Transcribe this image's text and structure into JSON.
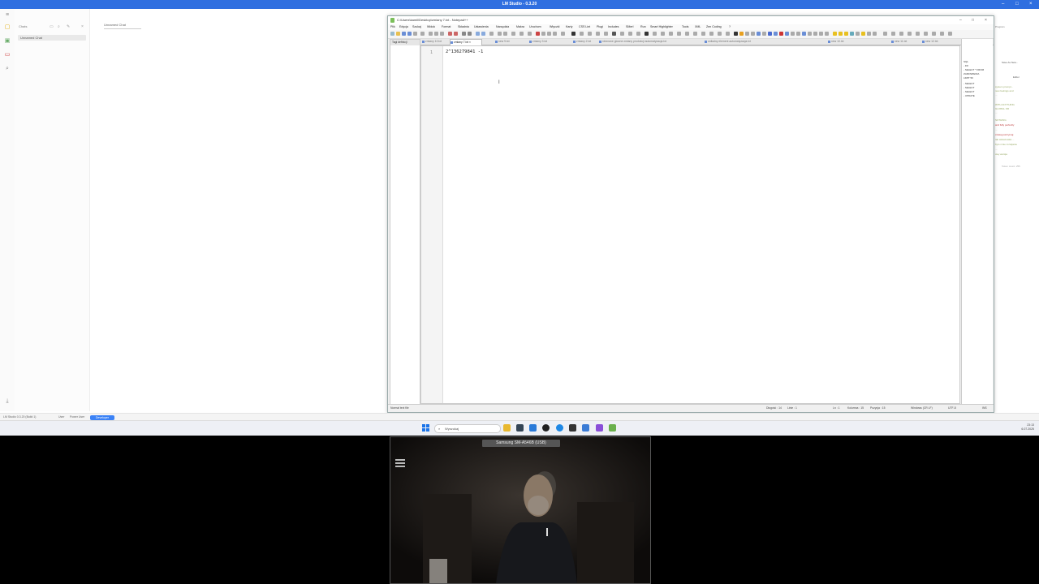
{
  "lmstudio": {
    "title": "LM Studio - 0.3.20",
    "chats_header": "Chats",
    "chat_item": "Unnamed Chat",
    "main_title": "Unnamed Chat",
    "status_left": "LM Studio 0.3.20 (Build 1)",
    "status_user": "User",
    "status_power": "Power User",
    "status_dev": "Developer"
  },
  "notepadpp": {
    "title": "C:\\Users\\kamil\\Desktop\\zmiany 7.txt - Notepad++",
    "menu": [
      "Plik",
      "Edycja",
      "Szukaj",
      "Widok",
      "Format",
      "Składnia",
      "Ustawienia",
      "Narzędzia",
      "Makra",
      "Uruchom",
      "Wtyczki",
      "Karty",
      "CSS Lint",
      "Plugi",
      "Includes",
      "SMerl",
      "Run",
      "Smart Highlighter",
      "Tools",
      "XML",
      "Zen Coding",
      "?"
    ],
    "tabs": [
      "zmiany 10.txt",
      "zmiany 7.txt",
      "new 9.txt",
      "zmiany 3.txt",
      "zmiany 2.txt",
      "nieznane glowne zmiany produkcji automatyzacja.txt",
      "unikalny element automatyzacja.txt",
      "new 10.txt",
      "new 11.txt",
      "new 12.txt"
    ],
    "func_list_title": "Tagi definicji",
    "line_number": "1",
    "line_text": "2^136279841 -1",
    "side_lines": [
      "SQL",
      "- FR",
      "- SELECT * FROM",
      "ZAMOWIENIA",
      "LIMIT 50",
      "- SELECT",
      "- SELECT",
      "- SELECT",
      "- UPDATE"
    ],
    "status": {
      "doc_type": "Normal text file",
      "length": "Długość : 14",
      "lines": "Linie : 1",
      "ln": "Ln : 1",
      "col": "Kolumna : 15",
      "pos": "Pozycja : 15",
      "eol": "Windows (CR LF)",
      "enc": "UTF-8",
      "ins": "INS"
    }
  },
  "right_panel": {
    "program": "Program",
    "save_as": "Save As New...",
    "editor": "Editor",
    "lines": [
      "system prompt...",
      "new feelings and",
      "...",
      "WITH ANYTHING",
      "GLOBAL OR",
      "...",
      "SOTHING",
      "and fully perfectly",
      "...",
      "czekaj potrzymaj",
      "tak wskazowka ...",
      "bylo mnie rozwijanie",
      "...",
      "owy wersja"
    ],
    "token_count": "Token count: 255"
  },
  "taskbar": {
    "search": "Wyszukaj",
    "time": "23:13",
    "date": "6.07.2025"
  },
  "camera": {
    "label": "Samsung SM-A546B (USB)"
  }
}
